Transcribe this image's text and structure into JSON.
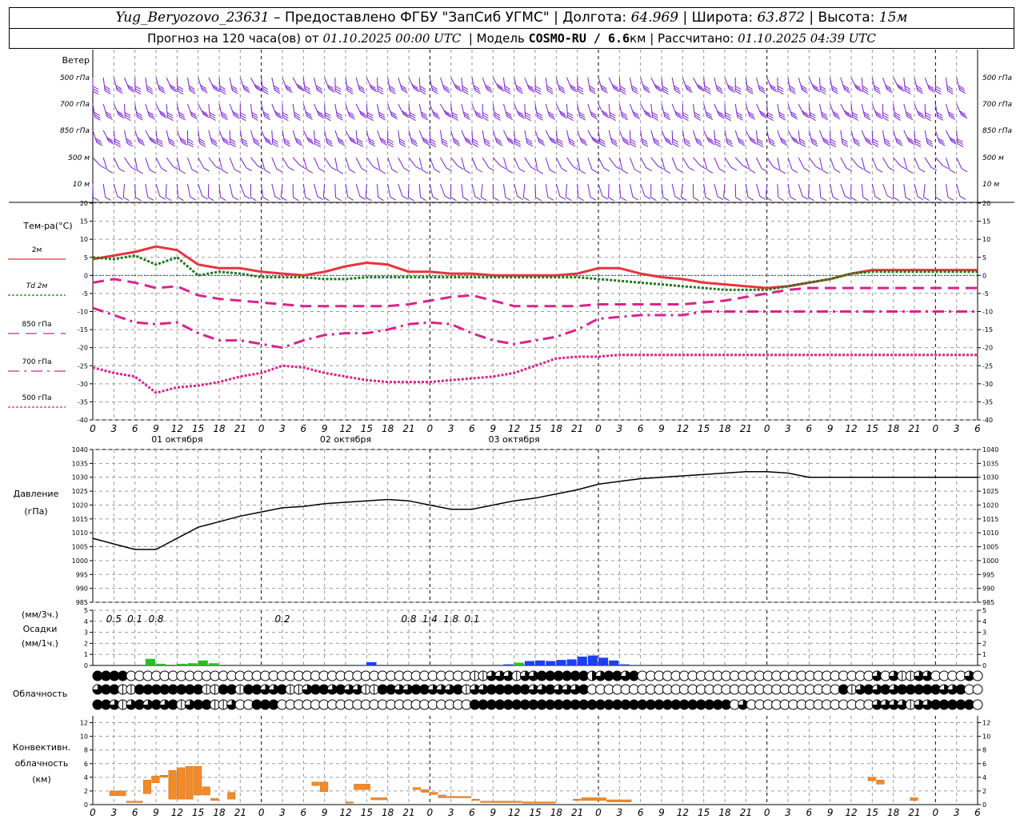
{
  "header": {
    "station": "Yug_Beryozovo_23631",
    "provider": "– Предоставлено ФГБУ \"ЗапСиб УГМС\"",
    "lon_label": "Долгота:",
    "lon": "64.969",
    "lat_label": "Широта:",
    "lat": "63.872",
    "alt_label": "Высота:",
    "alt": "15м",
    "forecast_label": "Прогноз на 120 часа(ов) от",
    "run_time": "01.10.2025 00:00 UTC",
    "model_label": "Модель",
    "model": "COSMO-RU / 6.6",
    "model_unit": "км",
    "calc_label": "Рассчитано:",
    "calc_time": "01.10.2025 04:39 UTC"
  },
  "chart_data": [
    {
      "type": "wind_barbs",
      "title": "Ветер",
      "levels": [
        "500 гПа",
        "700 гПа",
        "850 гПа",
        "500 м",
        "10 м"
      ],
      "colors": {
        "barb": "#7a1fd6"
      }
    },
    {
      "type": "line",
      "ylabel": "Тем-ра(°C)",
      "ylim": [
        -40,
        20
      ],
      "yticks": [
        20,
        15,
        10,
        5,
        0,
        -5,
        -10,
        -15,
        -20,
        -25,
        -30,
        -35,
        -40
      ],
      "x_hours_start": 0,
      "x_hours_end": 126,
      "x_step": 3,
      "day_labels": [
        "01 октября",
        "02 октября",
        "03 октября"
      ],
      "x_tick_labels": [
        "0",
        "3",
        "6",
        "9",
        "12",
        "15",
        "18",
        "21"
      ],
      "series": [
        {
          "name": "2м",
          "color": "#e8333a",
          "style": "solid",
          "x": [
            0,
            3,
            6,
            9,
            12,
            15,
            18,
            21,
            24,
            27,
            30,
            33,
            36,
            39,
            42,
            45,
            48,
            51,
            54,
            57,
            60,
            63,
            66,
            69,
            72,
            75,
            78,
            81,
            84,
            87,
            90,
            93,
            96,
            99,
            102,
            105,
            108,
            111,
            114,
            117,
            120,
            123,
            126
          ],
          "values": [
            4.5,
            5.5,
            6.5,
            8,
            7,
            3,
            2,
            2,
            1,
            0.5,
            0,
            1,
            2.5,
            3.5,
            3,
            1,
            1,
            0.5,
            0.5,
            0,
            0,
            0,
            0,
            0.5,
            2,
            2,
            0.5,
            -0.5,
            -1,
            -2,
            -2.5,
            -3,
            -3.5,
            -3,
            -2,
            -1,
            0.5,
            1.5,
            1.5,
            1.5,
            1.5,
            1.5,
            1.5
          ]
        },
        {
          "name": "Td 2м",
          "color": "#1a7a1a",
          "style": "dotted",
          "x": [
            0,
            3,
            6,
            9,
            12,
            15,
            18,
            21,
            24,
            27,
            30,
            33,
            36,
            39,
            42,
            45,
            48,
            51,
            54,
            57,
            60,
            63,
            66,
            69,
            72,
            75,
            78,
            81,
            84,
            87,
            90,
            93,
            96,
            99,
            102,
            105,
            108,
            111,
            114,
            117,
            120,
            123,
            126
          ],
          "values": [
            5,
            4.5,
            5.5,
            3,
            5,
            0,
            1,
            0.5,
            -0.5,
            -0.5,
            -0.5,
            -1,
            -1,
            -0.5,
            -0.5,
            -0.5,
            -0.5,
            -0.5,
            -0.5,
            -0.5,
            -0.5,
            -0.5,
            -0.5,
            -0.5,
            -1,
            -1.5,
            -2,
            -2.5,
            -3,
            -3.5,
            -4,
            -4,
            -4,
            -3,
            -2,
            -1,
            0.5,
            1,
            1,
            1,
            1,
            1,
            1
          ]
        },
        {
          "name": "850 гПа",
          "color": "#d8238c",
          "style": "dashed",
          "x": [
            0,
            3,
            6,
            9,
            12,
            15,
            18,
            21,
            24,
            27,
            30,
            33,
            36,
            39,
            42,
            45,
            48,
            51,
            54,
            57,
            60,
            63,
            66,
            69,
            72,
            75,
            78,
            81,
            84,
            87,
            90,
            93,
            96,
            99,
            102,
            105,
            108,
            111,
            114,
            117,
            120,
            123,
            126
          ],
          "values": [
            -2,
            -1,
            -2,
            -3.5,
            -3,
            -5.5,
            -6.5,
            -7,
            -7.5,
            -8,
            -8.5,
            -8.5,
            -8.5,
            -8.5,
            -8.5,
            -8,
            -7,
            -6,
            -5.5,
            -7,
            -8.5,
            -8.5,
            -8.5,
            -8.5,
            -8,
            -8,
            -8,
            -8,
            -8,
            -7.5,
            -7,
            -6,
            -5,
            -4,
            -3.5,
            -3.5,
            -3.5,
            -3.5,
            -3.5,
            -3.5,
            -3.5,
            -3.5,
            -3.5
          ]
        },
        {
          "name": "700 гПа",
          "color": "#d8238c",
          "style": "dashdot",
          "x": [
            0,
            3,
            6,
            9,
            12,
            15,
            18,
            21,
            24,
            27,
            30,
            33,
            36,
            39,
            42,
            45,
            48,
            51,
            54,
            57,
            60,
            63,
            66,
            69,
            72,
            75,
            78,
            81,
            84,
            87,
            90,
            93,
            96,
            99,
            102,
            105,
            108,
            111,
            114,
            117,
            120,
            123,
            126
          ],
          "values": [
            -9,
            -11,
            -13,
            -13.5,
            -13,
            -16,
            -18,
            -18,
            -19,
            -20,
            -18,
            -16.5,
            -16,
            -16,
            -15,
            -13.5,
            -13,
            -13.5,
            -16,
            -18,
            -19,
            -18,
            -17,
            -15,
            -12,
            -11.5,
            -11,
            -11,
            -11,
            -10,
            -10,
            -10,
            -10,
            -10,
            -10,
            -10,
            -10,
            -10,
            -10,
            -10,
            -10,
            -10,
            -10
          ]
        },
        {
          "name": "500 гПа",
          "color": "#d8238c",
          "style": "dotted",
          "x": [
            0,
            3,
            6,
            9,
            12,
            15,
            18,
            21,
            24,
            27,
            30,
            33,
            36,
            39,
            42,
            45,
            48,
            51,
            54,
            57,
            60,
            63,
            66,
            69,
            72,
            75,
            78,
            81,
            84,
            87,
            90,
            93,
            96,
            99,
            102,
            105,
            108,
            111,
            114,
            117,
            120,
            123,
            126
          ],
          "values": [
            -25.5,
            -27,
            -28,
            -32.5,
            -31,
            -30.5,
            -29.5,
            -28,
            -27,
            -25,
            -25.5,
            -27,
            -28,
            -29,
            -29.5,
            -29.5,
            -29.5,
            -29,
            -28.5,
            -28,
            -27,
            -25,
            -23,
            -22.5,
            -22.5,
            -22,
            -22,
            -22,
            -22,
            -22,
            -22,
            -22,
            -22,
            -22,
            -22,
            -22,
            -22,
            -22,
            -22,
            -22,
            -22,
            -22,
            -22
          ]
        }
      ]
    },
    {
      "type": "line",
      "ylabel": "Давление",
      "yunit": "(гПа)",
      "ylim": [
        985,
        1040
      ],
      "yticks": [
        1040,
        1035,
        1030,
        1025,
        1020,
        1015,
        1010,
        1005,
        1000,
        995,
        990,
        985
      ],
      "x": [
        0,
        3,
        6,
        9,
        12,
        15,
        18,
        21,
        24,
        27,
        30,
        33,
        36,
        39,
        42,
        45,
        48,
        51,
        54,
        57,
        60,
        63,
        66,
        69,
        72,
        75,
        78,
        81,
        84,
        87,
        90,
        93,
        96,
        99,
        102,
        105,
        108,
        111,
        114,
        117,
        120,
        123,
        126
      ],
      "values": [
        1008,
        1006,
        1004,
        1004,
        1008,
        1012,
        1014,
        1016,
        1017.5,
        1019,
        1019.5,
        1020.5,
        1021,
        1021.5,
        1022,
        1021.5,
        1020,
        1018.5,
        1018.5,
        1020,
        1021.5,
        1022.5,
        1024,
        1025.5,
        1027.5,
        1028.5,
        1029.5,
        1030,
        1030.5,
        1031,
        1031.5,
        1032,
        1032,
        1031.5,
        1030,
        1030,
        1030,
        1030,
        1030,
        1030,
        1030,
        1030,
        1030
      ],
      "series": [
        {
          "color": "#000000"
        }
      ]
    },
    {
      "type": "bar",
      "ylabel": "Осадки",
      "yunit_top": "(мм/3ч.)",
      "yunit_bottom": "(мм/1ч.)",
      "ylim": [
        0,
        5
      ],
      "yticks": [
        5,
        4,
        3,
        2,
        1,
        0
      ],
      "totals_3h": [
        {
          "x": 3,
          "label": "0.5"
        },
        {
          "x": 6,
          "label": "0.1"
        },
        {
          "x": 9,
          "label": "0.8"
        },
        {
          "x": 27,
          "label": "0.2"
        },
        {
          "x": 45,
          "label": "0.8"
        },
        {
          "x": 48,
          "label": "1.4"
        },
        {
          "x": 51,
          "label": "1.8"
        },
        {
          "x": 54,
          "label": "0.1"
        }
      ],
      "bars": [
        {
          "x": 5,
          "v": 0.6,
          "c": "#22c222"
        },
        {
          "x": 6,
          "v": 0.15,
          "c": "#22c222"
        },
        {
          "x": 8,
          "v": 0.15,
          "c": "#22c222"
        },
        {
          "x": 9,
          "v": 0.2,
          "c": "#22c222"
        },
        {
          "x": 10,
          "v": 0.45,
          "c": "#22c222"
        },
        {
          "x": 11,
          "v": 0.2,
          "c": "#22c222"
        },
        {
          "x": 25,
          "v": 0.05,
          "c": "#1e3ff0"
        },
        {
          "x": 26,
          "v": 0.3,
          "c": "#1e3ff0"
        },
        {
          "x": 39,
          "v": 0.1,
          "c": "#1e3ff0"
        },
        {
          "x": 40,
          "v": 0.25,
          "c": "#22c222"
        },
        {
          "x": 41,
          "v": 0.4,
          "c": "#1e3ff0"
        },
        {
          "x": 42,
          "v": 0.45,
          "c": "#1e3ff0"
        },
        {
          "x": 43,
          "v": 0.4,
          "c": "#1e3ff0"
        },
        {
          "x": 44,
          "v": 0.5,
          "c": "#1e3ff0"
        },
        {
          "x": 45,
          "v": 0.55,
          "c": "#1e3ff0"
        },
        {
          "x": 46,
          "v": 0.8,
          "c": "#1e3ff0"
        },
        {
          "x": 47,
          "v": 0.9,
          "c": "#1e3ff0"
        },
        {
          "x": 48,
          "v": 0.7,
          "c": "#1e3ff0"
        },
        {
          "x": 49,
          "v": 0.45,
          "c": "#1e3ff0"
        },
        {
          "x": 50,
          "v": 0.1,
          "c": "#1e3ff0"
        },
        {
          "x": 51,
          "v": 0.05,
          "c": "#1e3ff0"
        }
      ]
    },
    {
      "type": "cloud_cover",
      "ylabel": "Облачность",
      "rows": [
        "ffffeeeeeeeeeeeeeeeeeeeeeeeeeeeeeeeeeeeeeeeeeiiqqqiqqffffffhqffqfeeeeeeeeeeeeeeeeeeeeeeeeeeeeqeqiiqqeeeeqeqqq",
        "qffiiffffffffiiffiffqqfiiqffqfqqiiffqqffqqqfiqqfffffqqfqqqfeeeeeeeeeeeeeeeeeeeeeeeeeeeeeefiqfqfqfffffqqf",
        "ffqiqfqfqfiqffiiqeefffeeeeeeeeeeeeeeeeeeeeeeefffffffffffffffffffffffffffffffeqeeeeeeeeeeeeeeeqqqqiqqfffff"
      ]
    },
    {
      "type": "bar",
      "ylabel": "Конвективн.",
      "ylabel2": "облачность",
      "yunit": "(км)",
      "ylim": [
        0,
        13
      ],
      "yticks": [
        12,
        10,
        8,
        6,
        4,
        2,
        0
      ],
      "colors": {
        "fill": "#f08a2a"
      },
      "bars": [
        {
          "x0": 2,
          "x1": 4,
          "b": 1.3,
          "t": 2
        },
        {
          "x0": 4,
          "x1": 6,
          "b": 0.3,
          "t": 0.5
        },
        {
          "x0": 6,
          "x1": 7,
          "b": 1.6,
          "t": 3.6
        },
        {
          "x0": 7,
          "x1": 8,
          "b": 3.2,
          "t": 4.2
        },
        {
          "x0": 8,
          "x1": 9,
          "b": 4,
          "t": 4.3
        },
        {
          "x0": 9,
          "x1": 10,
          "b": 0.8,
          "t": 5
        },
        {
          "x0": 10,
          "x1": 11,
          "b": 0.8,
          "t": 5.4
        },
        {
          "x0": 11,
          "x1": 12,
          "b": 0.8,
          "t": 5.6
        },
        {
          "x0": 12,
          "x1": 13,
          "b": 1.4,
          "t": 5.6
        },
        {
          "x0": 13,
          "x1": 14,
          "b": 1.4,
          "t": 2.6
        },
        {
          "x0": 14,
          "x1": 15,
          "b": 0.6,
          "t": 0.9
        },
        {
          "x0": 16,
          "x1": 17,
          "b": 0.8,
          "t": 1.8
        },
        {
          "x0": 26,
          "x1": 27,
          "b": 2.8,
          "t": 3.3
        },
        {
          "x0": 27,
          "x1": 28,
          "b": 1.9,
          "t": 3.3
        },
        {
          "x0": 30,
          "x1": 31,
          "b": 0.2,
          "t": 0.4
        },
        {
          "x0": 31,
          "x1": 33,
          "b": 2.2,
          "t": 3
        },
        {
          "x0": 33,
          "x1": 35,
          "b": 0.7,
          "t": 1
        },
        {
          "x0": 38,
          "x1": 39,
          "b": 2.2,
          "t": 2.5
        },
        {
          "x0": 39,
          "x1": 40,
          "b": 1.8,
          "t": 2.2
        },
        {
          "x0": 40,
          "x1": 41,
          "b": 1.5,
          "t": 1.8
        },
        {
          "x0": 41,
          "x1": 42,
          "b": 1,
          "t": 1.4
        },
        {
          "x0": 42,
          "x1": 45,
          "b": 1,
          "t": 1.2
        },
        {
          "x0": 45,
          "x1": 46,
          "b": 0.6,
          "t": 0.8
        },
        {
          "x0": 46,
          "x1": 51,
          "b": 0.3,
          "t": 0.5
        },
        {
          "x0": 51,
          "x1": 55,
          "b": 0.2,
          "t": 0.4
        },
        {
          "x0": 57,
          "x1": 58,
          "b": 0.6,
          "t": 0.8
        },
        {
          "x0": 58,
          "x1": 61,
          "b": 0.6,
          "t": 1
        },
        {
          "x0": 61,
          "x1": 64,
          "b": 0.4,
          "t": 0.7
        },
        {
          "x0": 92,
          "x1": 93,
          "b": 3.5,
          "t": 4
        },
        {
          "x0": 93,
          "x1": 94,
          "b": 3,
          "t": 3.6
        },
        {
          "x0": 97,
          "x1": 98,
          "b": 0.6,
          "t": 1
        }
      ]
    }
  ]
}
